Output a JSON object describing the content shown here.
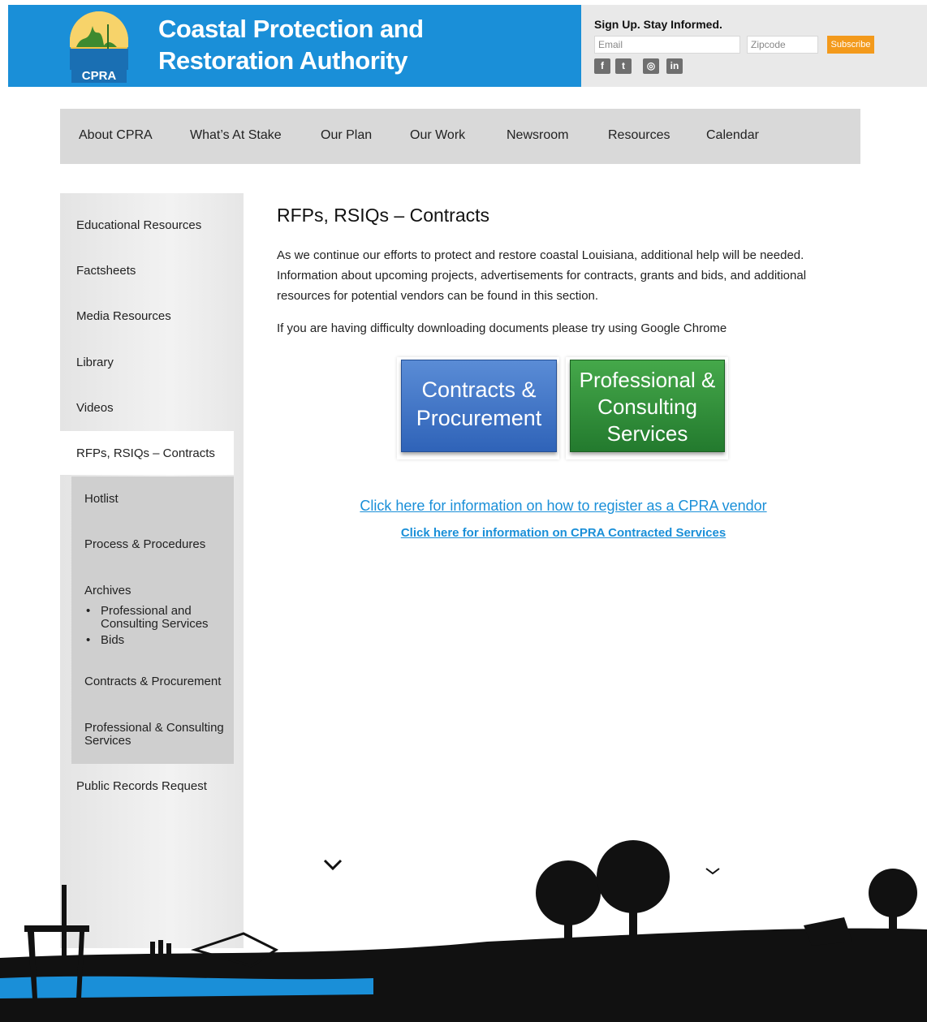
{
  "header": {
    "logo_text": "CPRA",
    "title_line1": "Coastal Protection and",
    "title_line2": "Restoration Authority",
    "signup_title": "Sign Up. Stay Informed.",
    "email_placeholder": "Email",
    "zip_placeholder": "Zipcode",
    "subscribe_label": "Subscribe",
    "social": [
      "facebook-icon",
      "twitter-icon",
      "instagram-icon",
      "linkedin-icon"
    ],
    "social_glyphs": [
      "f",
      "t",
      "◎",
      "in"
    ],
    "colors": {
      "brand_blue": "#1a8fd8",
      "subscribe_orange": "#f39a1c"
    }
  },
  "nav": {
    "items": [
      "About CPRA",
      "What’s At Stake",
      "Our Plan",
      "Our Work",
      "Newsroom",
      "Resources",
      "Calendar"
    ]
  },
  "sidebar": {
    "items": [
      "Educational Resources",
      "Factsheets",
      "Media Resources",
      "Library",
      "Videos",
      "RFPs, RSIQs – Contracts"
    ],
    "sub_items": [
      "Hotlist",
      "Process & Procedures",
      "Archives"
    ],
    "archive_children": [
      "Professional and Consulting Services",
      "Bids"
    ],
    "sub_items_after": [
      "Contracts & Procurement",
      "Professional & Consulting Services"
    ],
    "last_item": "Public Records Request"
  },
  "main": {
    "title": "RFPs, RSIQs – Contracts",
    "paragraph": "As we continue our efforts to protect and restore coastal Louisiana, additional help will be needed. Information about upcoming projects, advertisements for contracts, grants and bids, and additional resources for potential vendors can be found in this section.",
    "note": "If you are having difficulty downloading documents please try using Google Chrome",
    "button_contracts": "Contracts & Procurement",
    "button_professional": "Professional & Consulting Services",
    "link_register": "Click here for information on how to register as a CPRA vendor",
    "link_contracted": "Click here for information on CPRA Contracted Services"
  }
}
